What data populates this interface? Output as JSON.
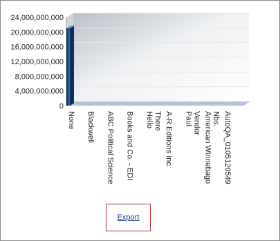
{
  "chart_data": {
    "type": "bar",
    "categories": [
      "None",
      "Blackwell",
      "ABC Political Science",
      "Books and Co. - EDI",
      "Hello\nThere",
      "A-R Editions Inc.",
      "Paul\nVendor",
      "American Winnebago\nNbs.",
      "AutoQA_01051205​49"
    ],
    "values": [
      21000000000,
      0,
      0,
      0,
      0,
      0,
      0,
      0,
      0
    ],
    "ylim": [
      0,
      24000000000
    ],
    "y_ticks": [
      "0",
      "4,000,000,000",
      "8,000,000,000",
      "12,000,000,000",
      "16,000,000,000",
      "20,000,000,000",
      "24,000,000,000"
    ],
    "title": "",
    "xlabel": "",
    "ylabel": "",
    "grid": true,
    "colors": {
      "bar": "#1f4f8a",
      "bar_dark": "#0d2f5c",
      "wall": "#dfe3e8",
      "floor": "#9fb4d0"
    }
  },
  "footer": {
    "export_label": "Export"
  }
}
